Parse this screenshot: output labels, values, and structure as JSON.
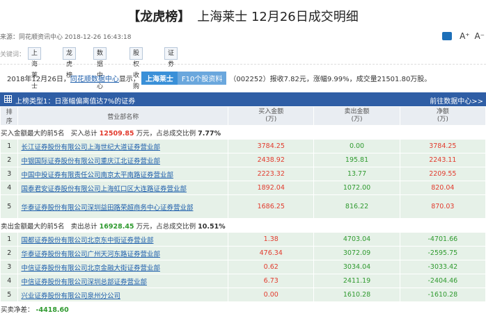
{
  "header": {
    "bracket_title": "【龙虎榜】",
    "title": "上海莱士  12月26日成交明细"
  },
  "source": {
    "text": "来源：同花顺资讯中心  2018-12-26  16:43:18",
    "font_plus": "A⁺",
    "font_minus": "A⁻"
  },
  "keywords": {
    "label": "关键词：",
    "items": [
      "上海莱士",
      "龙虎榜",
      "数据中心",
      "股权收购",
      "证券业"
    ]
  },
  "summary": {
    "prefix": "2018年12月26日，",
    "link": "同花顺数据中心",
    "mid": "显示，",
    "stock_name": "上海莱士",
    "f10": "F10个股资料",
    "tail": "（002252）报收7.82元，涨幅9.99%，成交量21501.80万股。"
  },
  "bar": {
    "title": "上榜类型1：日涨幅偏离值达7%的证券",
    "link": "前往数据中心>>"
  },
  "table": {
    "headers": {
      "rank": "排序",
      "name": "营业部名称",
      "buy": "买入金额\n(万)",
      "sell": "卖出金额\n(万)",
      "net": "净额\n(万)"
    },
    "buy_section": {
      "label": "买入金额最大的前5名",
      "total_label": "买入总计",
      "total": "12509.85",
      "unit": "万元，占总成交比例",
      "ratio": "7.77%"
    },
    "buy_rows": [
      {
        "rank": "1",
        "name": "长江证券股份有限公司上海世纪大道证券营业部",
        "buy": "3784.25",
        "sell": "0.00",
        "net": "3784.25"
      },
      {
        "rank": "2",
        "name": "中银国际证券股份有限公司重庆江北证券营业部",
        "buy": "2438.92",
        "sell": "195.81",
        "net": "2243.11"
      },
      {
        "rank": "3",
        "name": "中国中投证券有限责任公司南京太平南路证券营业部",
        "buy": "2223.32",
        "sell": "13.77",
        "net": "2209.55"
      },
      {
        "rank": "4",
        "name": "国泰君安证券股份有限公司上海虹口区大连路证券营业部",
        "buy": "1892.04",
        "sell": "1072.00",
        "net": "820.04"
      },
      {
        "rank": "5",
        "name": "华泰证券股份有限公司深圳益田路荣超商务中心证券营业部",
        "buy": "1686.25",
        "sell": "816.22",
        "net": "870.03"
      }
    ],
    "sell_section": {
      "label": "卖出金额最大的前5名",
      "total_label": "卖出总计",
      "total": "16928.45",
      "unit": "万元，占总成交比例",
      "ratio": "10.51%"
    },
    "sell_rows": [
      {
        "rank": "1",
        "name": "国都证券股份有限公司北京东中街证券营业部",
        "buy": "1.38",
        "sell": "4703.04",
        "net": "-4701.66"
      },
      {
        "rank": "2",
        "name": "华泰证券股份有限公司广州天河东路证券营业部",
        "buy": "476.34",
        "sell": "3072.09",
        "net": "-2595.75"
      },
      {
        "rank": "3",
        "name": "中信证券股份有限公司北京金融大街证券营业部",
        "buy": "0.62",
        "sell": "3034.04",
        "net": "-3033.42"
      },
      {
        "rank": "4",
        "name": "中信证券股份有限公司深圳总部证券营业部",
        "buy": "6.73",
        "sell": "2411.19",
        "net": "-2404.46"
      },
      {
        "rank": "5",
        "name": "兴业证券股份有限公司泉州分公司",
        "buy": "0.00",
        "sell": "1610.28",
        "net": "-1610.28"
      }
    ],
    "net_label": "买卖净差：",
    "net_value": "-4418.60"
  },
  "colors": {
    "bar_bg": "#2f5ea5",
    "row_bg": "#e6f1e8",
    "red": "#e23b2e",
    "green": "#2f9a2f",
    "link": "#1d5eab"
  }
}
